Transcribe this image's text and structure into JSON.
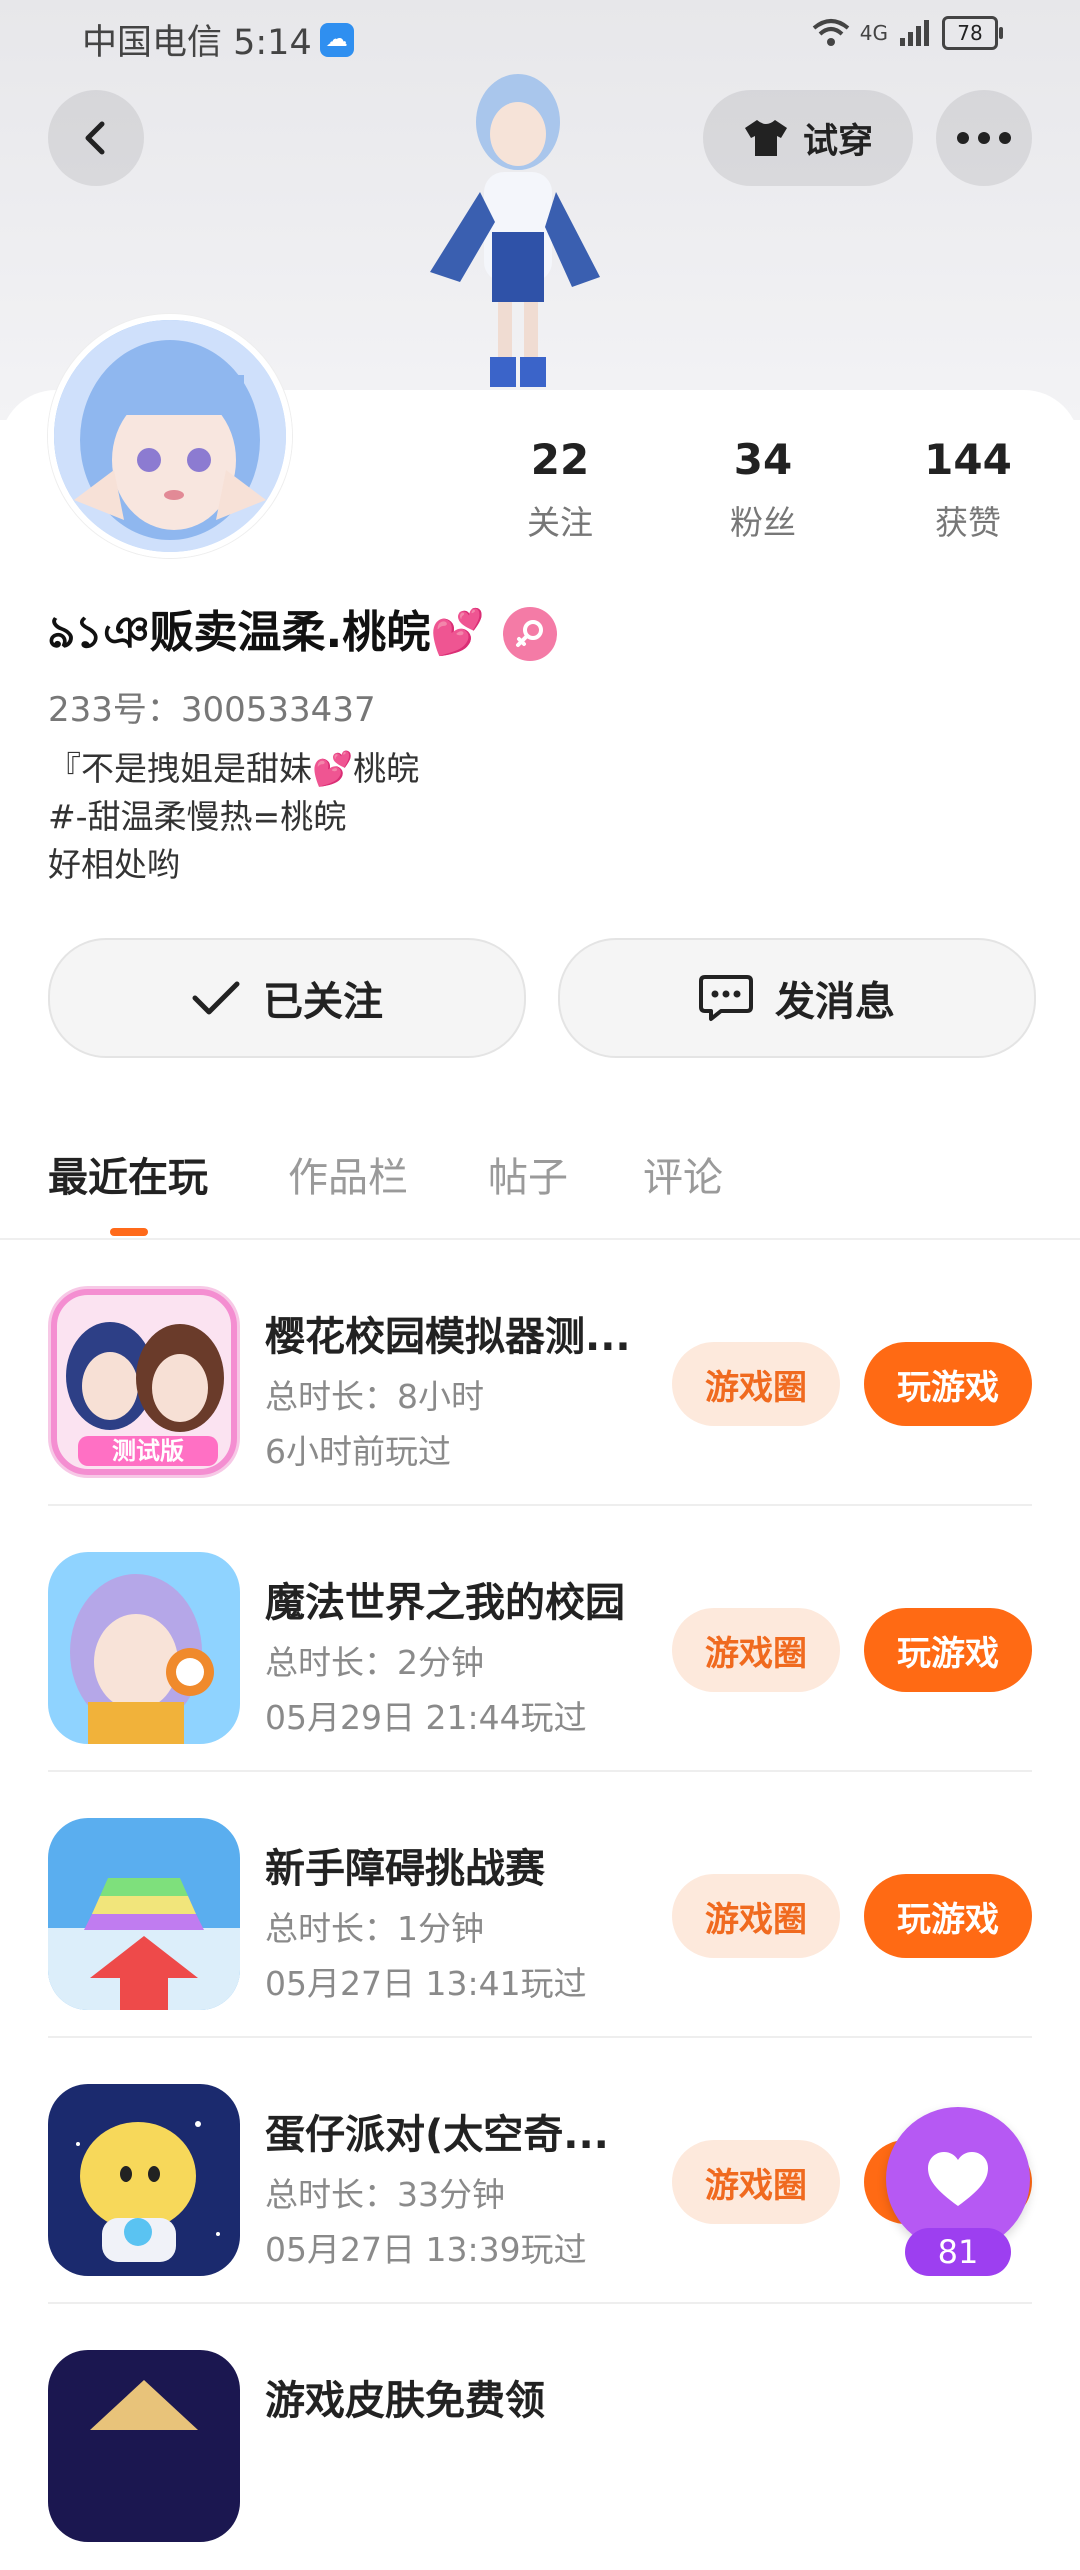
{
  "status_bar": {
    "carrier_time": "中国电信 5:14",
    "network": "4G",
    "battery": "78"
  },
  "header": {
    "try_on_label": "试穿"
  },
  "profile": {
    "stats": [
      {
        "value": "22",
        "label": "关注"
      },
      {
        "value": "34",
        "label": "粉丝"
      },
      {
        "value": "144",
        "label": "获赞"
      }
    ],
    "name": "ঌ১ঞ贩卖温柔.桃皖💕",
    "id_line": "233号：300533437",
    "bio_lines": [
      "『不是拽姐是甜妹💕桃皖",
      "#-甜温柔慢热=桃皖",
      "好相处哟"
    ]
  },
  "actions": {
    "follow_label": "已关注",
    "message_label": "发消息"
  },
  "tabs": [
    "最近在玩",
    "作品栏",
    "帖子",
    "评论"
  ],
  "games": [
    {
      "title": "樱花校园模拟器测...",
      "duration": "总时长：8小时",
      "last_played": "6小时前玩过",
      "icon_badge": "测试版",
      "circle_label": "游戏圈",
      "play_label": "玩游戏"
    },
    {
      "title": "魔法世界之我的校园",
      "duration": "总时长：2分钟",
      "last_played": "05月29日 21:44玩过",
      "circle_label": "游戏圈",
      "play_label": "玩游戏"
    },
    {
      "title": "新手障碍挑战赛",
      "duration": "总时长：1分钟",
      "last_played": "05月27日 13:41玩过",
      "circle_label": "游戏圈",
      "play_label": "玩游戏"
    },
    {
      "title": "蛋仔派对(太空奇...",
      "duration": "总时长：33分钟",
      "last_played": "05月27日 13:39玩过",
      "circle_label": "游戏圈",
      "play_label": "玩游戏"
    },
    {
      "title": "游戏皮肤免费领",
      "duration": "",
      "last_played": "",
      "circle_label": "",
      "play_label": ""
    }
  ],
  "like_fab": {
    "count": "81"
  },
  "colors": {
    "accent": "#ff6a14",
    "accent_soft": "#fde9dc",
    "like": "#b659f3"
  }
}
